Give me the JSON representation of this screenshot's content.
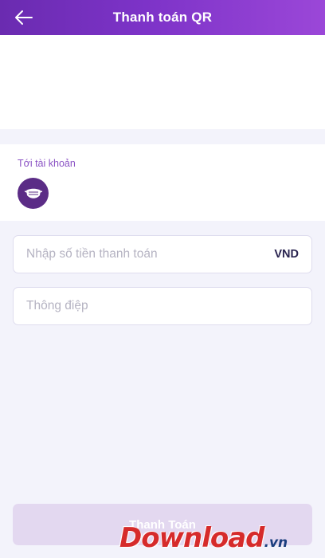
{
  "header": {
    "title": "Thanh toán QR",
    "back_icon": "arrow-left-icon",
    "gradient_colors": [
      "#6a2bb0",
      "#9b47d8"
    ]
  },
  "account": {
    "label": "Tới tài khoản",
    "avatar_icon": "face-mask-icon",
    "avatar_color": "#5b2c86"
  },
  "amount_field": {
    "placeholder": "Nhập số tiền thanh toán",
    "value": "",
    "currency": "VND"
  },
  "message_field": {
    "placeholder": "Thông điệp",
    "value": ""
  },
  "pay_button": {
    "label": "Thanh Toán",
    "color": "#e3d8f0"
  },
  "watermark": {
    "text": "Download",
    "suffix": ".vn"
  }
}
